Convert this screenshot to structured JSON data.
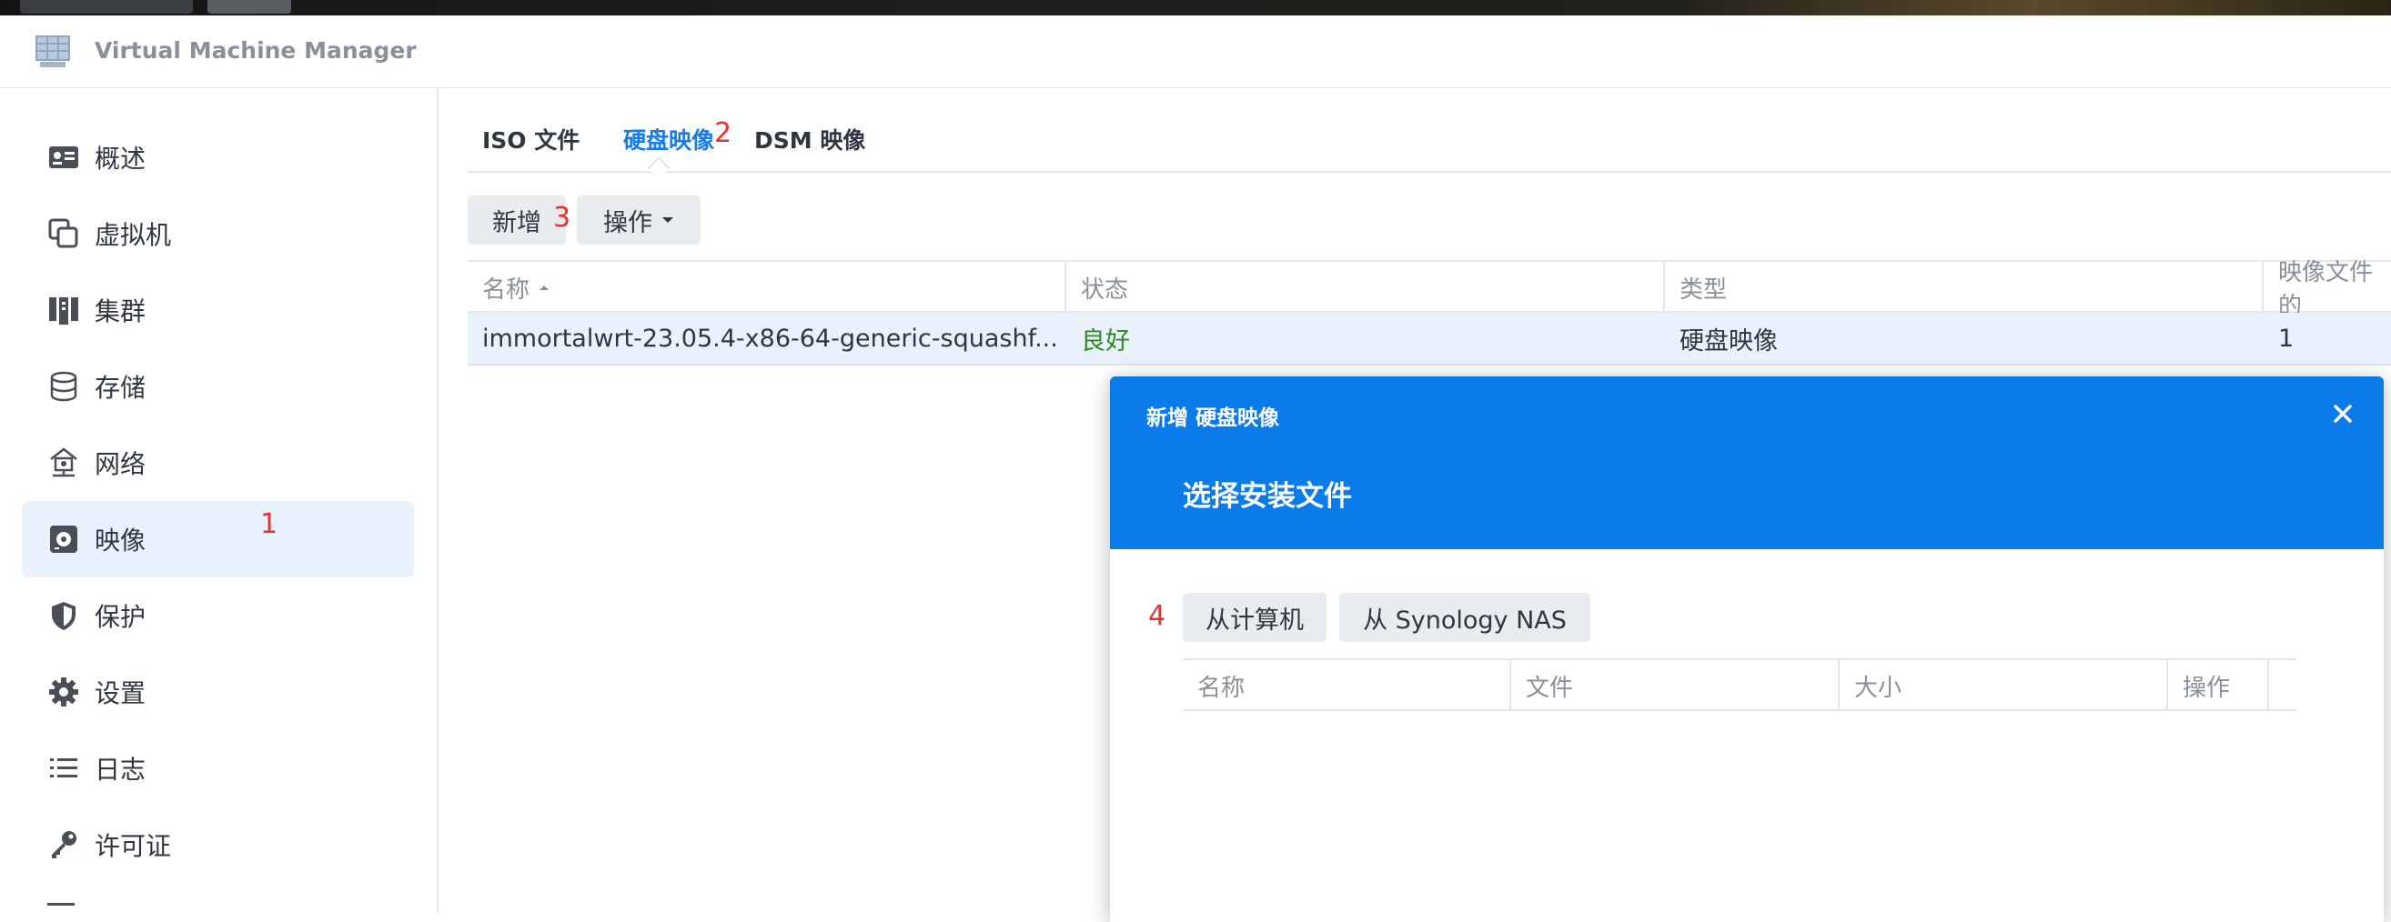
{
  "app": {
    "title": "Virtual Machine Manager"
  },
  "sidebar": {
    "items": [
      {
        "label": "概述",
        "icon": "overview-icon"
      },
      {
        "label": "虚拟机",
        "icon": "virtual-machine-icon"
      },
      {
        "label": "集群",
        "icon": "cluster-icon"
      },
      {
        "label": "存储",
        "icon": "storage-icon"
      },
      {
        "label": "网络",
        "icon": "network-icon"
      },
      {
        "label": "映像",
        "icon": "image-icon",
        "active": true
      },
      {
        "label": "保护",
        "icon": "shield-icon"
      },
      {
        "label": "设置",
        "icon": "gear-icon"
      },
      {
        "label": "日志",
        "icon": "list-icon"
      },
      {
        "label": "许可证",
        "icon": "key-icon"
      }
    ]
  },
  "annotations": {
    "a1": "1",
    "a2": "2",
    "a3": "3",
    "a4": "4"
  },
  "tabs": [
    {
      "label": "ISO 文件"
    },
    {
      "label": "硬盘映像",
      "active": true
    },
    {
      "label": "DSM 映像"
    }
  ],
  "toolbar": {
    "add_label": "新增",
    "action_label": "操作"
  },
  "table": {
    "columns": [
      "名称",
      "状态",
      "类型",
      "映像文件的"
    ],
    "rows": [
      {
        "name": "immortalwrt-23.05.4-x86-64-generic-squashf...",
        "status": "良好",
        "type": "硬盘映像",
        "count": "1"
      }
    ]
  },
  "dialog": {
    "title": "新增 硬盘映像",
    "subtitle": "选择安装文件",
    "buttons": {
      "from_computer": "从计算机",
      "from_nas": "从 Synology NAS"
    },
    "columns": [
      "名称",
      "文件",
      "大小",
      "操作"
    ]
  },
  "colors": {
    "accent": "#0a7be8",
    "active_tab": "#1a7ce6",
    "status_good": "#2e8b1e",
    "annotation": "#e8312f"
  }
}
